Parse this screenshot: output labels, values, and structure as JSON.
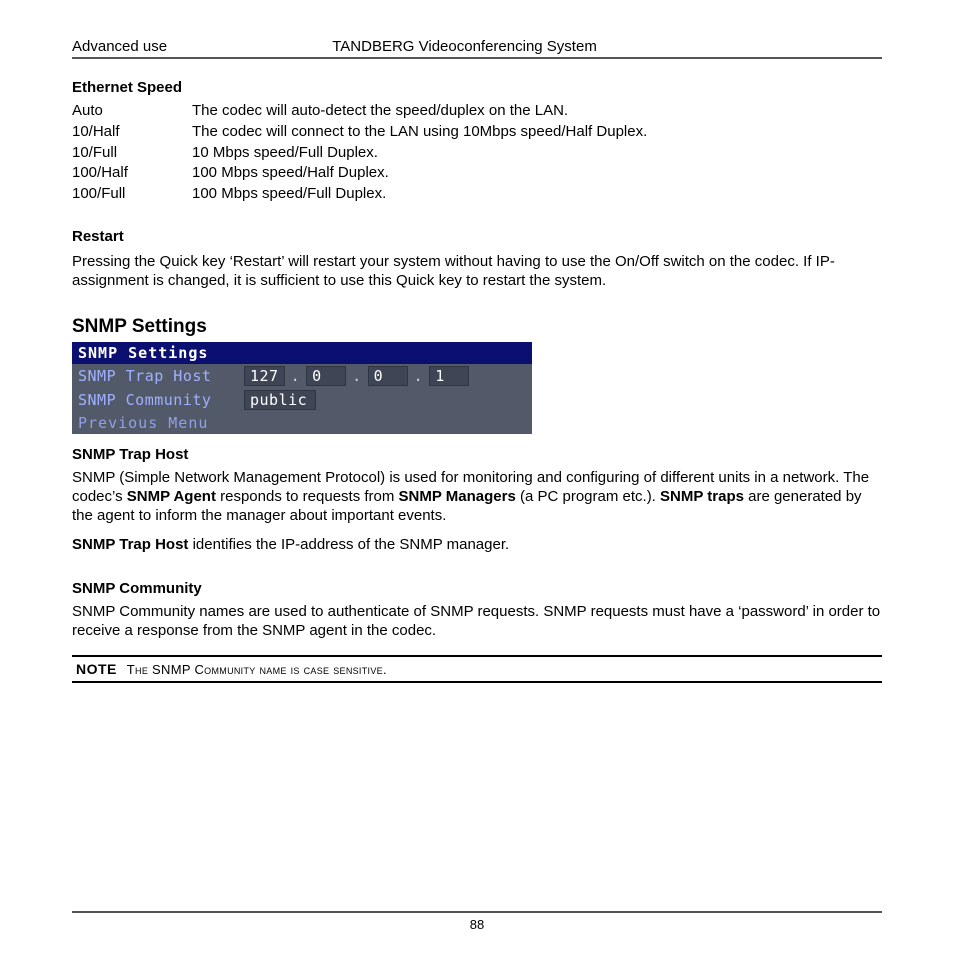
{
  "header": {
    "left": "Advanced use",
    "center": "TANDBERG Videoconferencing System"
  },
  "ethernet": {
    "heading": "Ethernet Speed",
    "rows": [
      {
        "term": "Auto",
        "desc": "The codec will auto-detect the speed/duplex on the LAN."
      },
      {
        "term": "10/Half",
        "desc": "The codec will connect to the LAN using 10Mbps speed/Half Duplex."
      },
      {
        "term": "10/Full",
        "desc": "10 Mbps speed/Full Duplex."
      },
      {
        "term": "100/Half",
        "desc": "100 Mbps speed/Half Duplex."
      },
      {
        "term": "100/Full",
        "desc": "100 Mbps speed/Full Duplex."
      }
    ]
  },
  "restart": {
    "heading": "Restart",
    "para": "Pressing the Quick key ‘Restart’ will restart your system without having to use the On/Off switch on the codec. If IP-assignment is changed, it is sufficient to use this Quick key to restart the system."
  },
  "snmp": {
    "heading": "SNMP Settings",
    "box": {
      "title": "SNMP Settings",
      "trap_label": "SNMP Trap Host",
      "ip": [
        "127",
        "0",
        "0",
        "1"
      ],
      "dot": ".",
      "community_label": "SNMP Community",
      "community_value": "public",
      "prev": "Previous Menu"
    },
    "traphost": {
      "heading": "SNMP Trap Host",
      "p1_a": "SNMP (Simple Network Management Protocol) is used for monitoring and configuring of different units in a network. The codec’s ",
      "p1_b": "SNMP Agent",
      "p1_c": " responds to requests from ",
      "p1_d": "SNMP Managers",
      "p1_e": " (a PC program etc.). ",
      "p1_f": "SNMP traps",
      "p1_g": " are generated by the agent to inform the manager about important events.",
      "p2_a": "SNMP Trap Host",
      "p2_b": " identifies the IP-address of the SNMP manager."
    },
    "community": {
      "heading": "SNMP Community",
      "p1": "SNMP Community names are used to authenticate of SNMP requests. SNMP requests must have a ‘password’ in order to receive a response from the SNMP agent in the codec."
    },
    "note": {
      "label": "NOTE",
      "text_a": "T",
      "text_b": "he SNMP C",
      "text_c": "ommunity name is case sensitive",
      "text_d": "."
    }
  },
  "footer": {
    "page": "88"
  }
}
